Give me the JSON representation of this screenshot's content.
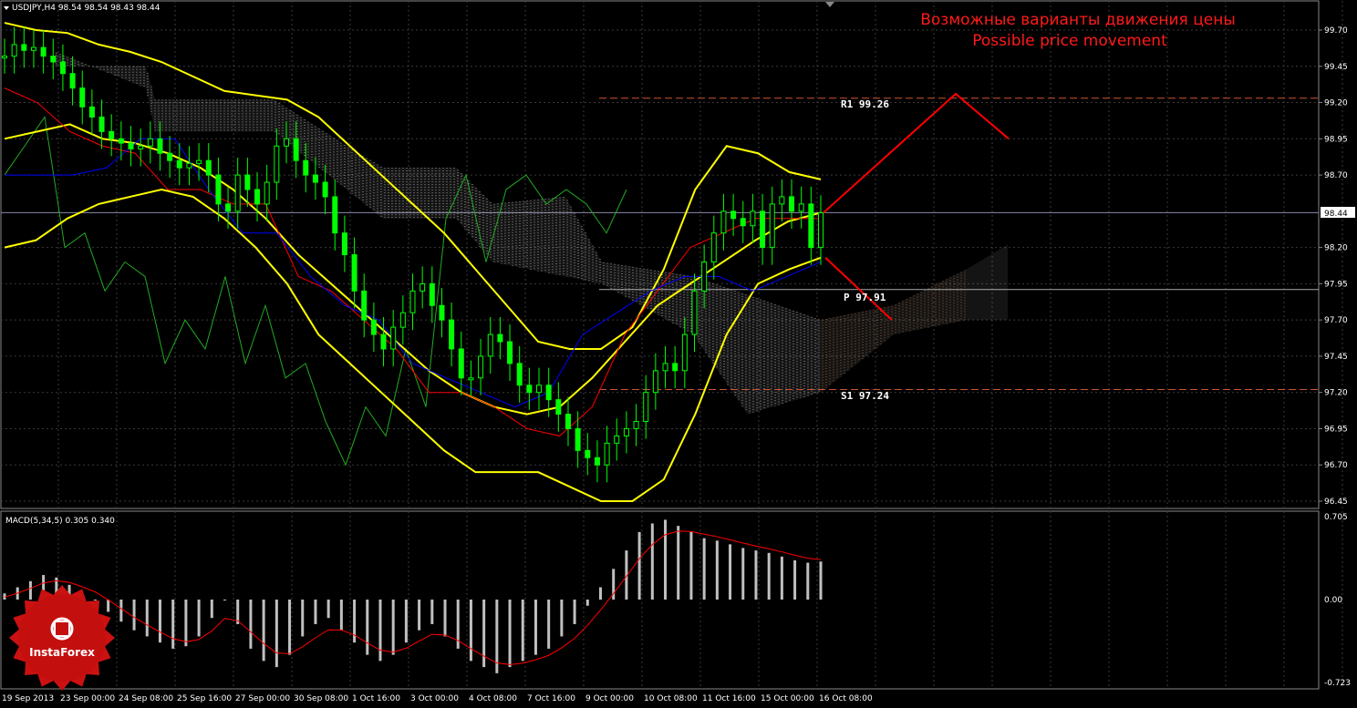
{
  "header": {
    "symbol_line": "USDJPY,H4  98.54 98.54 98.43 98.44"
  },
  "annotation": {
    "line1": "Возможные варианты движения цены",
    "line2": "Possible price movement"
  },
  "levels": [
    {
      "label": "R1 99.26",
      "value": 99.23
    },
    {
      "label": "P 97.91",
      "value": 97.91
    },
    {
      "label": "S1 97.24",
      "value": 97.24
    }
  ],
  "current_price_label": "98.44",
  "macd": {
    "title": "MACD(5,34,5) 0.305 0.340",
    "axis_labels": [
      "0.705",
      "0.00",
      "-0.723"
    ]
  },
  "price_axis_labels": [
    "99.70",
    "99.45",
    "99.20",
    "98.95",
    "98.70",
    "98.44",
    "98.20",
    "97.95",
    "97.70",
    "97.45",
    "97.20",
    "96.95",
    "96.70",
    "96.45"
  ],
  "x_labels": [
    "19 Sep 2013",
    "23 Sep 00:00",
    "24 Sep 08:00",
    "25 Sep 16:00",
    "27 Sep 00:00",
    "30 Sep 08:00",
    "1 Oct 16:00",
    "3 Oct 00:00",
    "4 Oct 08:00",
    "7 Oct 16:00",
    "9 Oct 00:00",
    "10 Oct 08:00",
    "11 Oct 16:00",
    "15 Oct 00:00",
    "16 Oct 08:00"
  ],
  "logo": {
    "text": "InstaForex"
  },
  "colors": {
    "candle": "#00ff00",
    "bollinger": "#ffff00",
    "tenkan": "#ff0000",
    "kijun": "#0000ff",
    "chikou": "#22aa22",
    "cloud": "#ffffff",
    "macd_hist": "#c0c0c0",
    "macd_signal": "#ff0000",
    "levels": "#cc5533",
    "forecast": "#ff0000"
  },
  "chart_data": {
    "type": "candlestick",
    "symbol": "USDJPY",
    "timeframe": "H4",
    "ylim": [
      96.4,
      99.85
    ],
    "candles_approx_close": [
      99.52,
      99.6,
      99.56,
      99.58,
      99.52,
      99.48,
      99.4,
      99.3,
      99.17,
      99.1,
      99.0,
      98.95,
      98.92,
      98.88,
      98.9,
      98.95,
      98.85,
      98.8,
      98.75,
      98.78,
      98.8,
      98.7,
      98.5,
      98.45,
      98.7,
      98.6,
      98.5,
      98.65,
      98.9,
      98.95,
      98.8,
      98.7,
      98.65,
      98.55,
      98.3,
      98.15,
      97.9,
      97.7,
      97.6,
      97.5,
      97.65,
      97.75,
      97.9,
      97.95,
      97.8,
      97.7,
      97.5,
      97.3,
      97.3,
      97.45,
      97.6,
      97.55,
      97.4,
      97.25,
      97.2,
      97.25,
      97.15,
      97.05,
      96.95,
      96.8,
      96.75,
      96.7,
      96.85,
      96.9,
      96.95,
      97.0,
      97.2,
      97.35,
      97.4,
      97.35,
      97.6,
      97.9,
      98.1,
      98.3,
      98.45,
      98.4,
      98.35,
      98.45,
      98.2,
      98.5,
      98.55,
      98.45,
      98.5,
      98.2,
      98.44
    ],
    "bollinger_upper": [
      99.75,
      99.7,
      99.68,
      99.6,
      99.55,
      99.48,
      99.38,
      99.28,
      99.25,
      99.22,
      99.1,
      98.9,
      98.7,
      98.5,
      98.3,
      98.05,
      97.8,
      97.55,
      97.5,
      97.5,
      97.65,
      98.05,
      98.6,
      98.9,
      98.85,
      98.72,
      98.67
    ],
    "bollinger_lower": [
      98.2,
      98.25,
      98.4,
      98.5,
      98.55,
      98.6,
      98.55,
      98.4,
      98.2,
      97.95,
      97.6,
      97.4,
      97.2,
      97.0,
      96.8,
      96.65,
      96.65,
      96.65,
      96.55,
      96.45,
      96.45,
      96.6,
      97.05,
      97.6,
      97.95,
      98.05,
      98.13
    ],
    "bollinger_mid": [
      98.95,
      99.0,
      99.05,
      98.95,
      98.92,
      98.85,
      98.75,
      98.6,
      98.4,
      98.15,
      97.95,
      97.75,
      97.55,
      97.35,
      97.2,
      97.1,
      97.05,
      97.1,
      97.3,
      97.55,
      97.8,
      97.95,
      98.1,
      98.25,
      98.38,
      98.44
    ],
    "macd_hist_approx": [
      0.05,
      0.1,
      0.15,
      0.2,
      0.18,
      0.12,
      0.05,
      0.0,
      -0.1,
      -0.18,
      -0.25,
      -0.3,
      -0.35,
      -0.4,
      -0.38,
      -0.3,
      -0.15,
      0.0,
      -0.2,
      -0.4,
      -0.5,
      -0.55,
      -0.45,
      -0.3,
      -0.2,
      -0.15,
      -0.25,
      -0.35,
      -0.45,
      -0.5,
      -0.45,
      -0.35,
      -0.25,
      -0.2,
      -0.3,
      -0.4,
      -0.5,
      -0.55,
      -0.6,
      -0.55,
      -0.5,
      -0.45,
      -0.4,
      -0.3,
      -0.2,
      -0.05,
      0.1,
      0.25,
      0.4,
      0.55,
      0.62,
      0.65,
      0.6,
      0.55,
      0.5,
      0.48,
      0.45,
      0.42,
      0.4,
      0.38,
      0.35,
      0.32,
      0.3,
      0.31
    ],
    "forecast": {
      "up_target": 99.26,
      "down_target": 97.7,
      "start_value": 98.44
    }
  }
}
